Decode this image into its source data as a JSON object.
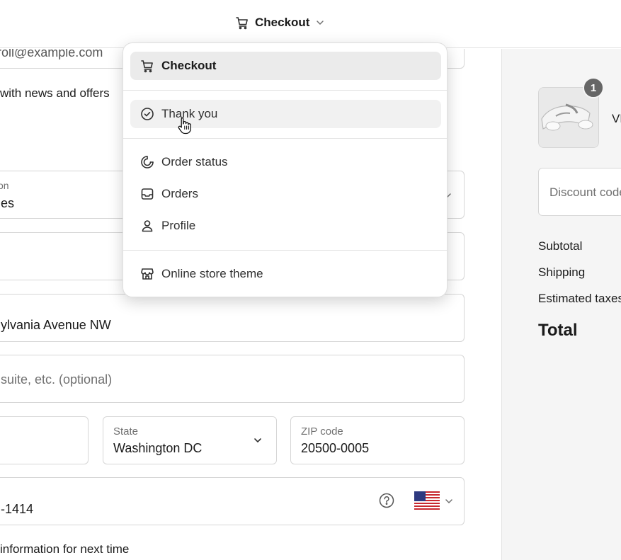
{
  "header": {
    "page_title": "Checkout"
  },
  "menu": {
    "items": [
      {
        "label": "Checkout",
        "icon": "cart-icon",
        "state": "selected"
      },
      {
        "label": "Thank you",
        "icon": "check-circle-icon",
        "state": "hovered"
      },
      {
        "label": "Order status",
        "icon": "order-status-icon",
        "state": "normal"
      },
      {
        "label": "Orders",
        "icon": "inbox-icon",
        "state": "normal"
      },
      {
        "label": "Profile",
        "icon": "person-icon",
        "state": "normal"
      },
      {
        "label": "Online store theme",
        "icon": "store-icon",
        "state": "normal"
      }
    ]
  },
  "form": {
    "email_partial": "roll@example.com",
    "news_checkbox_label": "with news and offers",
    "country_label": "on",
    "country_value": "es",
    "address_value": "ylvania Avenue NW",
    "apartment_placeholder": "suite, etc. (optional)",
    "state_label": "State",
    "state_value": "Washington DC",
    "zip_label": "ZIP code",
    "zip_value": "20500-0005",
    "phone_value": "-1414",
    "save_info_label": "information for next time"
  },
  "summary": {
    "product_qty": "1",
    "product_name": "VR",
    "discount_placeholder": "Discount code",
    "subtotal_label": "Subtotal",
    "shipping_label": "Shipping",
    "taxes_label": "Estimated taxes",
    "total_label": "Total"
  },
  "colors": {
    "menu_selected_bg": "#ebebeb",
    "menu_hover_bg": "#f1f1f1",
    "summary_bg": "#f5f5f5",
    "badge_bg": "#666666",
    "border": "#d6d6d6"
  }
}
